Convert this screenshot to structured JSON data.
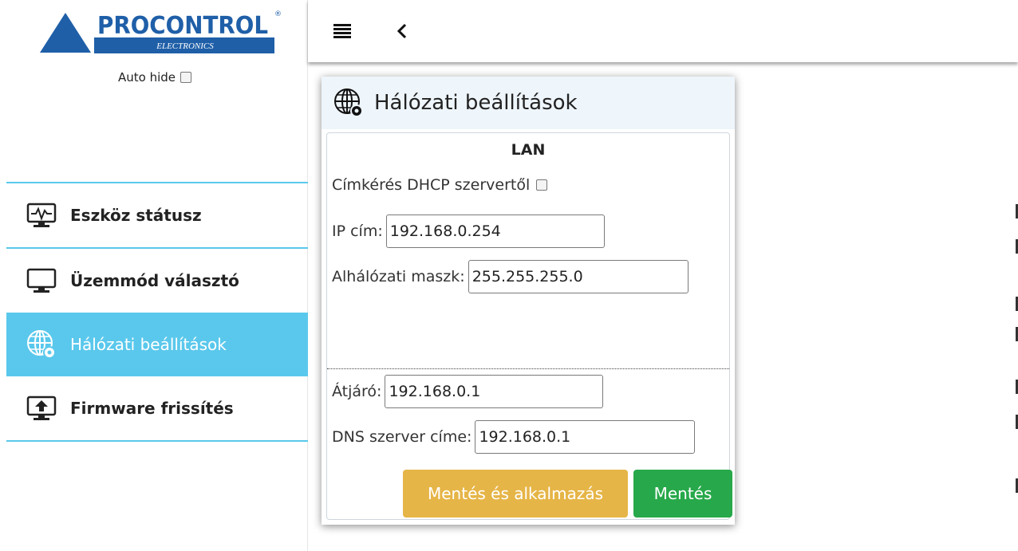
{
  "brand": {
    "name": "PROCONTROL",
    "sub": "ELECTRONICS",
    "registered": "®"
  },
  "auto_hide": {
    "label": "Auto hide",
    "checked": false
  },
  "menu": [
    {
      "label": "Eszköz státusz",
      "icon": "device-status-icon",
      "active": false
    },
    {
      "label": "Üzemmód választó",
      "icon": "monitor-icon",
      "active": false
    },
    {
      "label": "Hálózati beállítások",
      "icon": "network-settings-icon",
      "active": true
    },
    {
      "label": "Firmware frissítés",
      "icon": "firmware-upload-icon",
      "active": false
    }
  ],
  "topbar": {
    "menu_icon": "hamburger-icon",
    "back_icon": "chevron-left-icon"
  },
  "panel": {
    "title": "Hálózati beállítások",
    "section": "LAN",
    "dhcp_label": "Címkérés DHCP szervertől",
    "dhcp_checked": false,
    "ip_label": "IP cím:",
    "ip_value": "192.168.0.254",
    "mask_label": "Alhálózati maszk:",
    "mask_value": "255.255.255.0",
    "gateway_label": "Átjáró:",
    "gateway_value": "192.168.0.1",
    "dns_label": "DNS szerver címe:",
    "dns_value": "192.168.0.1",
    "apply_button": "Mentés és alkalmazás",
    "save_button": "Mentés"
  },
  "colors": {
    "accent": "#5ac8ec",
    "brand_blue": "#1f5fa8",
    "apply": "#e6b547",
    "save": "#27a84a",
    "panel_head": "#eef5fb"
  }
}
